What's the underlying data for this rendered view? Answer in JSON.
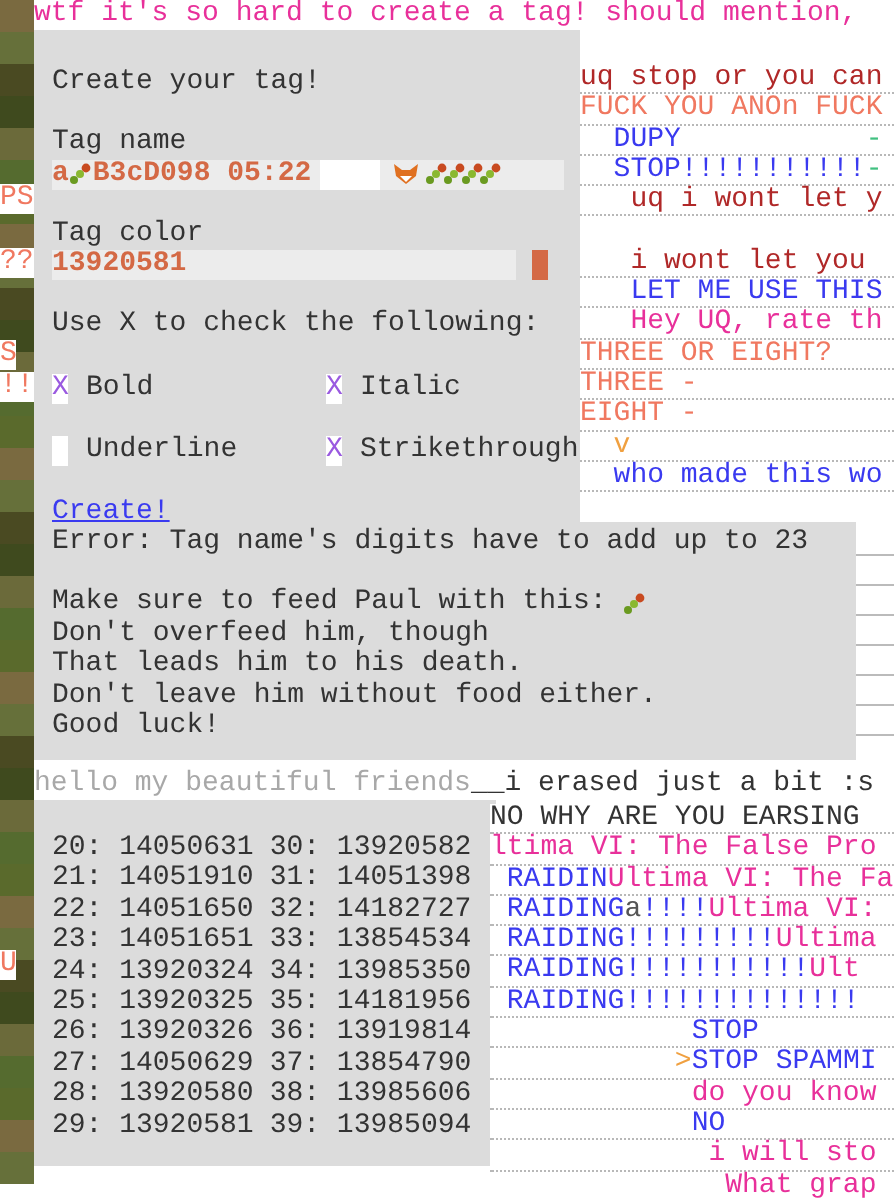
{
  "top_line": {
    "text": "wtf it's so hard to create a tag! should mention,",
    "color": "#e8309a"
  },
  "side_labels": [
    {
      "text": "PS"
    },
    {
      "text": "??"
    },
    {
      "text": "S"
    },
    {
      "text": "!!"
    },
    {
      "text": "U"
    }
  ],
  "form": {
    "title": "Create your tag!",
    "tag_name": {
      "label": "Tag name",
      "value_start": "a",
      "value_end": "B3cD098 05:22"
    },
    "tag_color": {
      "label": "Tag color",
      "value": "13920581"
    },
    "instruction": "Use X to check the following:",
    "options": [
      {
        "label": "Bold",
        "value": "X"
      },
      {
        "label": "Italic",
        "value": "X"
      },
      {
        "label": "Underline"
      },
      {
        "label": "Strikethrough",
        "value": "X"
      }
    ],
    "create_link": "Create!",
    "error": "Error: Tag name's digits have to add up to 23",
    "notes": [
      "Make sure to feed Paul with this:",
      "Don't overfeed him, though",
      "That leads him to his death.",
      "Don't leave him without food either.",
      "Good luck!"
    ]
  },
  "chat_upper": [
    {
      "segments": [
        {
          "text": "uq stop or you can",
          "color": "#b02828"
        }
      ]
    },
    {
      "segments": [
        {
          "text": "FUCK YOU ANOn FUCK",
          "color": "#f07860"
        }
      ]
    },
    {
      "segments": [
        {
          "text": "  DUPY",
          "color": "#3a3af0"
        },
        {
          "text": "           -",
          "color": "#40c080"
        }
      ]
    },
    {
      "segments": [
        {
          "text": "  STOP!!!!!!!!!!!",
          "color": "#3a3af0"
        },
        {
          "text": "-",
          "color": "#40c080"
        }
      ]
    },
    {
      "segments": [
        {
          "text": "   uq i wont let y",
          "color": "#b02828"
        }
      ]
    },
    {
      "segments": [
        {
          "text": "   i wont let you",
          "color": "#b02828"
        }
      ]
    },
    {
      "segments": [
        {
          "text": "   LET ME USE THIS",
          "color": "#3a3af0"
        }
      ]
    },
    {
      "segments": [
        {
          "text": "   Hey UQ, rate th",
          "color": "#e8309a"
        }
      ]
    },
    {
      "segments": [
        {
          "text": "THREE OR EIGHT?",
          "color": "#f07860"
        }
      ]
    },
    {
      "segments": [
        {
          "text": "THREE -",
          "color": "#f07860"
        }
      ]
    },
    {
      "segments": [
        {
          "text": "EIGHT -",
          "color": "#f07860"
        }
      ]
    },
    {
      "segments": [
        {
          "text": "  v",
          "color": "#f0a040"
        }
      ]
    },
    {
      "segments": [
        {
          "text": "  who made this wo",
          "color": "#3a3af0"
        }
      ]
    }
  ],
  "hello_line": {
    "faded": "hello my beautiful friends",
    "text": "__i erased just a bit :s"
  },
  "numbers": [
    [
      "20: 14050631",
      "30: 13920582"
    ],
    [
      "21: 14051910",
      "31: 14051398"
    ],
    [
      "22: 14051650",
      "32: 14182727"
    ],
    [
      "23: 14051651",
      "33: 13854534"
    ],
    [
      "24: 13920324",
      "34: 13985350"
    ],
    [
      "25: 13920325",
      "35: 14181956"
    ],
    [
      "26: 13920326",
      "36: 13919814"
    ],
    [
      "27: 14050629",
      "37: 13854790"
    ],
    [
      "28: 13920580",
      "38: 13985606"
    ],
    [
      "29: 13920581",
      "39: 13985094"
    ]
  ],
  "chat_lower": [
    {
      "segments": [
        {
          "text": "NO WHY ARE YOU EARSING",
          "color": "#333333"
        }
      ]
    },
    {
      "segments": [
        {
          "text": "ltima VI: The False Pro",
          "color": "#e8309a"
        }
      ]
    },
    {
      "segments": [
        {
          "text": " RAIDIN",
          "color": "#3a3af0"
        },
        {
          "text": "Ultima VI: The Fa",
          "color": "#e8309a"
        }
      ]
    },
    {
      "segments": [
        {
          "text": " RAIDING",
          "color": "#3a3af0"
        },
        {
          "text": "a",
          "color": "#555555"
        },
        {
          "text": "!!!!",
          "color": "#3a3af0"
        },
        {
          "text": "Ultima VI:",
          "color": "#e8309a"
        }
      ]
    },
    {
      "segments": [
        {
          "text": " RAIDING!!!!!!!!!",
          "color": "#3a3af0"
        },
        {
          "text": "Ultima",
          "color": "#e8309a"
        }
      ]
    },
    {
      "segments": [
        {
          "text": " RAIDING!!!!!!!!!!!",
          "color": "#3a3af0"
        },
        {
          "text": "Ult",
          "color": "#e8309a"
        }
      ]
    },
    {
      "segments": [
        {
          "text": " RAIDING!!!!!!!!!!!!!!",
          "color": "#3a3af0"
        }
      ]
    },
    {
      "segments": [
        {
          "text": "            STOP",
          "color": "#3a3af0"
        }
      ]
    },
    {
      "segments": [
        {
          "text": "           >",
          "color": "#f0a040"
        },
        {
          "text": "STOP SPAMMI",
          "color": "#3a3af0"
        }
      ]
    },
    {
      "segments": [
        {
          "text": "            do you know",
          "color": "#e8309a"
        }
      ]
    },
    {
      "segments": [
        {
          "text": "            NO",
          "color": "#3a3af0"
        }
      ]
    },
    {
      "segments": [
        {
          "text": "             i will sto",
          "color": "#e8309a"
        }
      ]
    },
    {
      "segments": [
        {
          "text": "              What grap",
          "color": "#e8309a"
        }
      ]
    }
  ]
}
